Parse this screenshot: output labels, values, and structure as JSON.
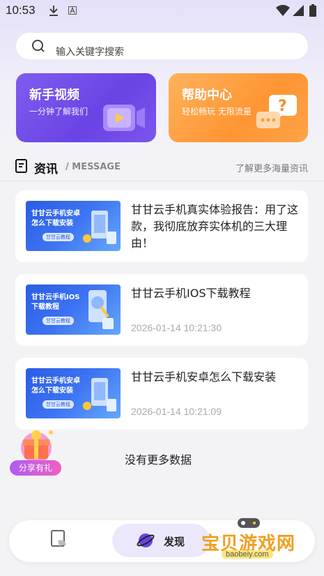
{
  "status_bar": {
    "time": "10:53"
  },
  "search": {
    "placeholder": "输入关键字搜索"
  },
  "cards": [
    {
      "title": "新手视频",
      "subtitle": "一分钟了解我们"
    },
    {
      "title": "帮助中心",
      "subtitle": "轻松畅玩 无限流量"
    }
  ],
  "news": {
    "title": "资讯",
    "subtitle": "/ MESSAGE",
    "more": "了解更多海量资讯"
  },
  "items": [
    {
      "title": "甘甘云手机真实体验报告：用了这款，我彻底放弃实体机的三大理由！",
      "date": "",
      "thumb_text": "甘甘云手机安卓怎么下载安装",
      "thumb_tag": "甘甘云教程"
    },
    {
      "title": "甘甘云手机IOS下载教程",
      "date": "2026-01-14 10:21:30",
      "thumb_text": "甘甘云手机IOS下载教程",
      "thumb_tag": "甘甘云教程"
    },
    {
      "title": "甘甘云手机安卓怎么下载安装",
      "date": "2026-01-14 10:21:09",
      "thumb_text": "甘甘云手机安卓怎么下载安装",
      "thumb_tag": "甘甘云教程"
    }
  ],
  "no_more": "没有更多数据",
  "share": {
    "label": "分享有礼"
  },
  "nav": {
    "discover": "发现"
  },
  "watermark": {
    "text": "宝贝游戏网",
    "url": "baobeiy.com"
  },
  "colors": {
    "guide_card": "#6a44e4",
    "help_card": "#ff9533",
    "accent": "#6a44e4"
  }
}
